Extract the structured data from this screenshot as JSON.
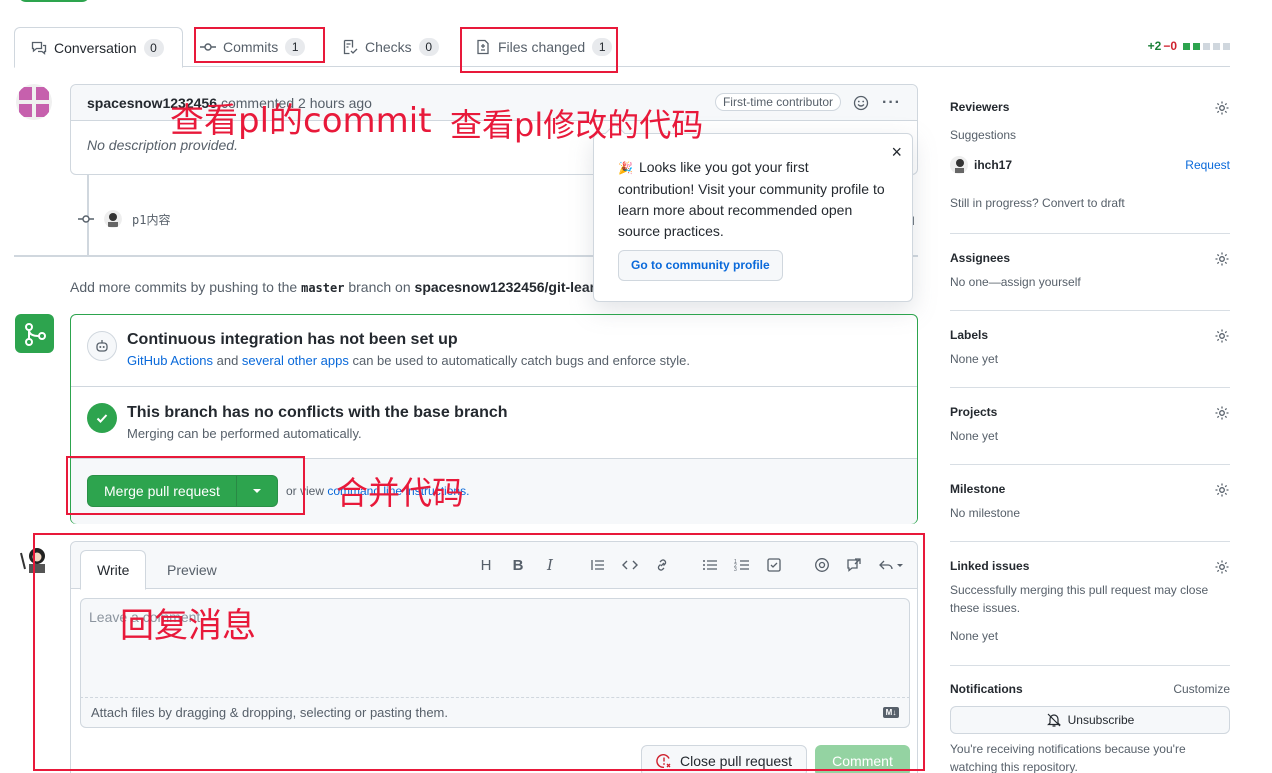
{
  "tabs": {
    "conversation": {
      "label": "Conversation",
      "count": "0"
    },
    "commits": {
      "label": "Commits",
      "count": "1"
    },
    "checks": {
      "label": "Checks",
      "count": "0"
    },
    "files_changed": {
      "label": "Files changed",
      "count": "1"
    },
    "diffstat": {
      "additions": "+2",
      "deletions": "−0"
    }
  },
  "comment": {
    "author": "spacesnow1232456",
    "meta": "commented 2 hours ago",
    "badge": "First-time contributor",
    "body": "No description provided."
  },
  "commit": {
    "message": "p1内容",
    "trail": "d"
  },
  "push_note": {
    "prefix": "Add more commits by pushing to the ",
    "branch": "master",
    "middle": " branch on ",
    "repo": "spacesnow1232456/git-lear"
  },
  "popover": {
    "emoji": "🎉",
    "text": "Looks like you got your first contribution! Visit your community profile to learn more about recommended open source practices.",
    "button": "Go to community profile",
    "close": "×"
  },
  "merge": {
    "ci_title": "Continuous integration has not been set up",
    "ci_link1": "GitHub Actions",
    "ci_and": " and ",
    "ci_link2": "several other apps",
    "ci_rest": " can be used to automatically catch bugs and enforce style.",
    "conflict_title": "This branch has no conflicts with the base branch",
    "conflict_sub": "Merging can be performed automatically.",
    "button": "Merge pull request",
    "or_view": "or view ",
    "cli_link": "command line instructions."
  },
  "reply": {
    "write": "Write",
    "preview": "Preview",
    "placeholder": "Leave a comment",
    "attach": "Attach files by dragging & dropping, selecting or pasting them.",
    "md": "M↓",
    "close_pr": "Close pull request",
    "comment": "Comment"
  },
  "sidebar": {
    "reviewers": {
      "title": "Reviewers",
      "suggestions": "Suggestions",
      "user": "ihch17",
      "request": "Request",
      "draft": "Still in progress? Convert to draft"
    },
    "assignees": {
      "title": "Assignees",
      "text": "No one—assign yourself"
    },
    "labels": {
      "title": "Labels",
      "text": "None yet"
    },
    "projects": {
      "title": "Projects",
      "text": "None yet"
    },
    "milestone": {
      "title": "Milestone",
      "text": "No milestone"
    },
    "linked": {
      "title": "Linked issues",
      "text": "Successfully merging this pull request may close these issues.",
      "none": "None yet"
    },
    "notifications": {
      "title": "Notifications",
      "customize": "Customize",
      "unsubscribe": "Unsubscribe",
      "text": "You're receiving notifications because you're watching this repository."
    }
  },
  "annotations": {
    "commit_note": "查看pl的commit",
    "files_note": "查看pl修改的代码",
    "merge_note": "合并代码",
    "reply_note": "回复消息"
  },
  "colors": {
    "accent_green": "#2da44e",
    "link_blue": "#0969da",
    "annotation_red": "#e8193a"
  }
}
